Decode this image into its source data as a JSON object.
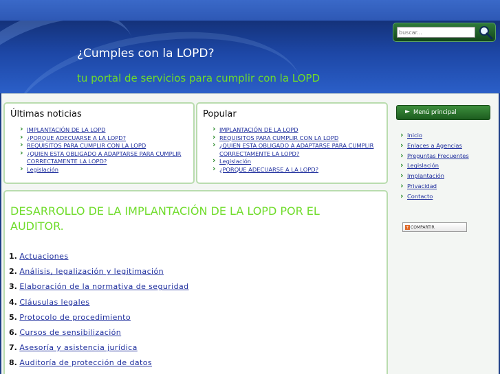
{
  "header": {
    "title": "¿Cumples con la LOPD?",
    "tagline": "tu portal de servicios para cumplir con la LOPD"
  },
  "search": {
    "placeholder": "buscar..."
  },
  "news": {
    "heading": "Últimas noticias",
    "items": [
      "IMPLANTACIÓN DE LA LOPD",
      "¿PORQUE ADECUARSE A LA LOPD?",
      "REQUISITOS PARA CUMPLIR CON LA LOPD",
      "¿QUIEN ESTA OBLIGADO A ADAPTARSE PARA CUMPLIR CORRECTAMENTE LA LOPD?",
      "Legislación"
    ]
  },
  "popular": {
    "heading": "Popular",
    "items": [
      "IMPLANTACIÓN DE LA LOPD",
      "REQUISITOS PARA CUMPLIR CON LA LOPD",
      "¿QUIEN ESTA OBLIGADO A ADAPTARSE PARA CUMPLIR CORRECTAMENTE LA LOPD?",
      "Legislación",
      "¿PORQUE ADECUARSE A LA LOPD?"
    ]
  },
  "article": {
    "title": "DESARROLLO DE LA IMPLANTACIÓN DE LA LOPD POR EL AUDITOR.",
    "items": [
      {
        "num": "1.",
        "label": "Actuaciones"
      },
      {
        "num": "2.",
        "label": "Análisis, legalización y legitimación"
      },
      {
        "num": "3.",
        "label": "Elaboración de la normativa de seguridad"
      },
      {
        "num": "4.",
        "label": "Cláusulas legales"
      },
      {
        "num": "5.",
        "label": "Protocolo de procedimiento"
      },
      {
        "num": "6.",
        "label": "Cursos de sensibilización"
      },
      {
        "num": "7.",
        "label": "Asesoría y asistencia jurídica"
      },
      {
        "num": "8.",
        "label": "Auditoría de protección de datos"
      }
    ]
  },
  "sidebar": {
    "menu_title": "Menú principal",
    "items": [
      "Inicio",
      "Enlaces a Agencias",
      "Preguntas Frecuentes",
      "Legislación",
      "Implantación",
      "Privacidad",
      "Contacto"
    ],
    "share_label": "COMPARTIR"
  },
  "colors": {
    "accent_green": "#6fdc2a",
    "header_blue": "#1d47a6",
    "link_blue": "#1f2f9e"
  }
}
